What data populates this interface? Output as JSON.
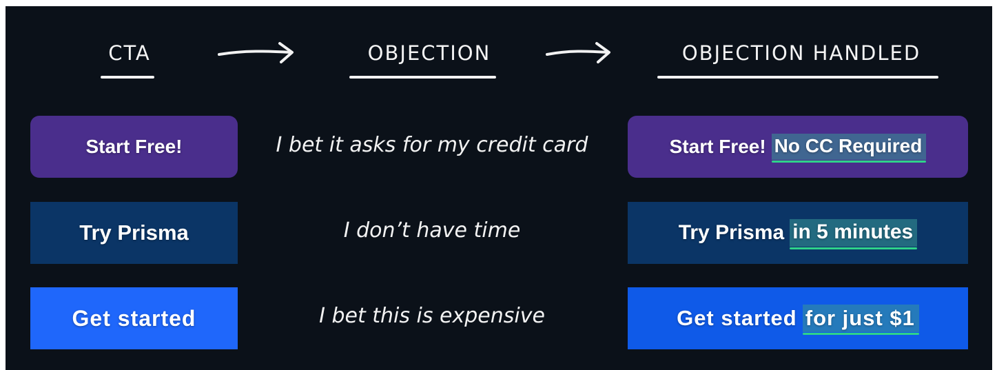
{
  "headers": {
    "cta": "CTA",
    "objection": "OBJECTION",
    "handled": "OBJECTION HANDLED"
  },
  "rows": [
    {
      "cta": "Start Free!",
      "objection": "I bet it asks for my credit card",
      "handled_base": "Start Free!",
      "handled_extra": "No CC Required",
      "color": "#4a2e8c"
    },
    {
      "cta": "Try Prisma",
      "objection": "I don’t have time",
      "handled_base": "Try Prisma",
      "handled_extra": "in 5 minutes",
      "color": "#0b3566"
    },
    {
      "cta": "Get started",
      "objection": "I bet this is expensive",
      "handled_base": "Get started",
      "handled_extra": "for just $1",
      "color": "#1f67fb"
    }
  ],
  "colors": {
    "background": "#0b1119",
    "highlight_underline": "#2fd38a"
  }
}
